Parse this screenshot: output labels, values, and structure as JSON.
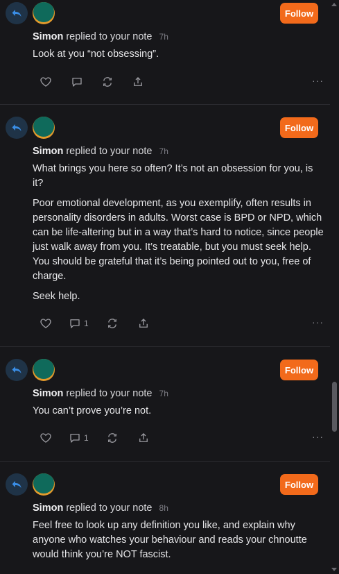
{
  "notes": [
    {
      "author": "Simon",
      "action": "replied to your note",
      "time": "7h",
      "follow": "Follow",
      "paragraphs": [
        "Look at you “not obsessing”."
      ],
      "comments": "",
      "more": "···"
    },
    {
      "author": "Simon",
      "action": "replied to your note",
      "time": "7h",
      "follow": "Follow",
      "paragraphs": [
        "What brings you here so often? It’s not an obsession for you, is it?",
        "Poor emotional development, as you exemplify, often results in personality disorders in adults. Worst case is BPD or NPD, which can be life-altering but in a way that’s hard to notice, since people just walk away from you. It’s treatable, but you must seek help. You should be grateful that it’s being pointed out to you, free of charge.",
        "Seek help."
      ],
      "comments": "1",
      "more": "···"
    },
    {
      "author": "Simon",
      "action": "replied to your note",
      "time": "7h",
      "follow": "Follow",
      "paragraphs": [
        "You can’t prove you’re not."
      ],
      "comments": "1",
      "more": "···"
    },
    {
      "author": "Simon",
      "action": "replied to your note",
      "time": "8h",
      "follow": "Follow",
      "paragraphs": [
        "Feel free to look up any definition you like, and explain why anyone who watches your behaviour and reads your chnoutte would think you’re NOT fascist."
      ],
      "comments": "",
      "more": "···"
    }
  ],
  "colors": {
    "accent": "#f26a1b",
    "background": "#17171a",
    "reply_badge": "#1f3347",
    "reply_icon": "#3a8ee6"
  },
  "icons": {
    "reply": "reply-arrow-icon",
    "like": "heart-icon",
    "comment": "comment-bubble-icon",
    "restack": "restack-icon",
    "share": "share-icon"
  }
}
